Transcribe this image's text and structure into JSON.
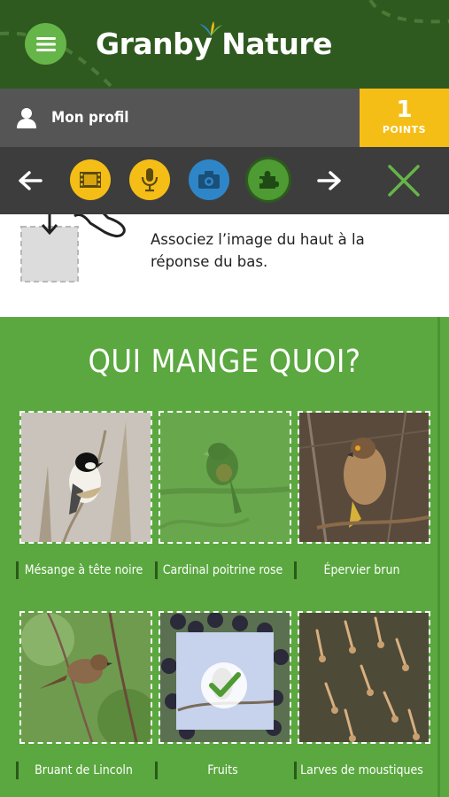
{
  "app": {
    "brand": "Granby Nature"
  },
  "profile": {
    "label": "Mon profil"
  },
  "points": {
    "value": "1",
    "label": "POINTS"
  },
  "toolbar": {
    "icons": [
      "arrow-left-icon",
      "film-icon",
      "microphone-icon",
      "camera-icon",
      "puzzle-icon",
      "arrow-right-icon",
      "close-icon"
    ],
    "colors": {
      "film": "#f5be16",
      "mic": "#f5be16",
      "camera": "#2e86c8",
      "puzzle": "#4e9a33",
      "close": "#66b548"
    }
  },
  "instruction": {
    "text": "Associez l’image du haut à la réponse du bas."
  },
  "game": {
    "title": "QUI MANGE QUOI?",
    "tiles": [
      {
        "caption": "Mésange à tête noire",
        "state": "normal"
      },
      {
        "caption": "Cardinal poitrine rose",
        "state": "selected"
      },
      {
        "caption": "Épervier brun",
        "state": "normal"
      },
      {
        "caption": "Bruant de Lincoln",
        "state": "normal"
      },
      {
        "caption": "Fruits",
        "state": "matched"
      },
      {
        "caption": "Larves de moustiques",
        "state": "normal"
      }
    ]
  }
}
